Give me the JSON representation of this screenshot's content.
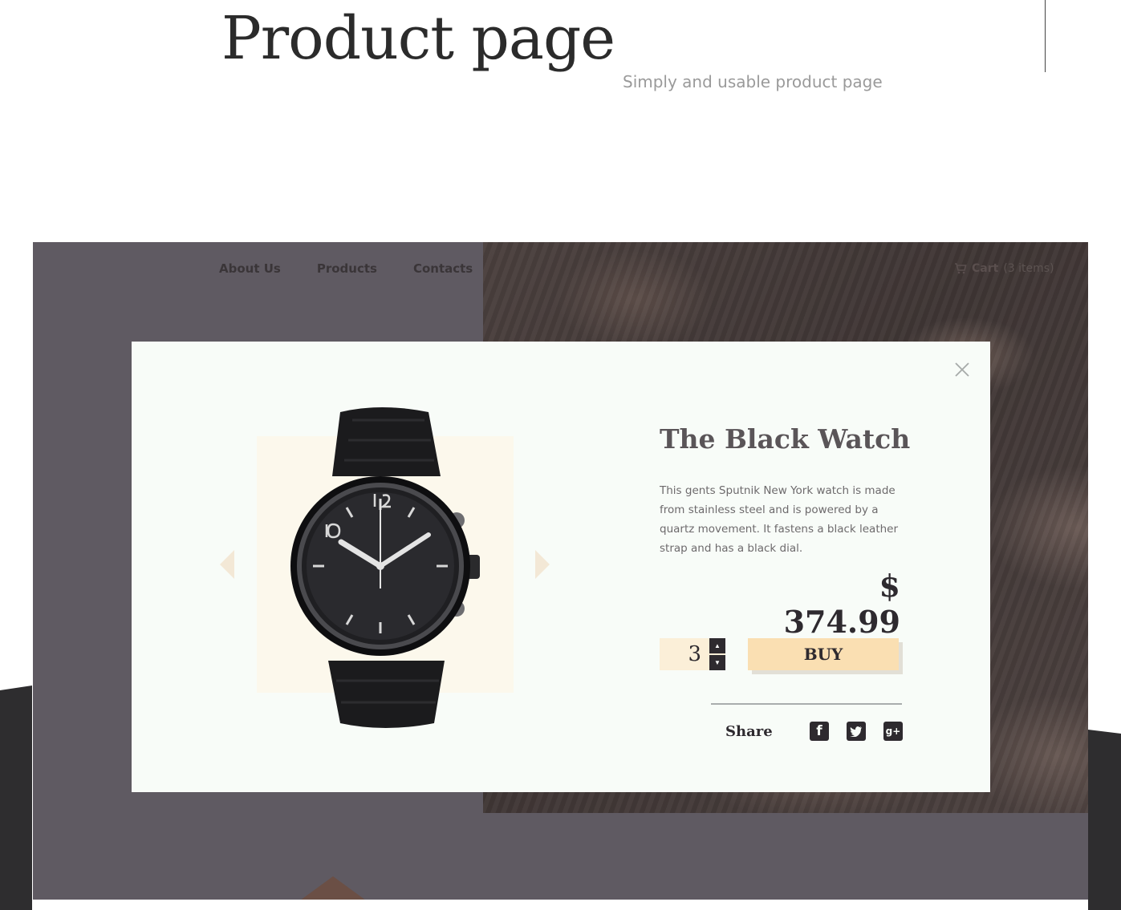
{
  "header": {
    "title": "Product page",
    "subtitle": "Simply and usable product page"
  },
  "nav": {
    "items": [
      "About Us",
      "Products",
      "Contacts"
    ],
    "cart_label": "Cart",
    "cart_count": "(3 items)"
  },
  "product": {
    "title": "The Black Watch",
    "description": "This gents Sputnik New York watch is made from stainless steel and is powered by a quartz movement. It fastens a black leather strap and has a black dial.",
    "price": "$ 374.99",
    "quantity": "3",
    "buy_label": "BUY",
    "share_label": "Share"
  },
  "icons": {
    "close": "close-icon",
    "prev": "chevron-left-icon",
    "next": "chevron-right-icon",
    "cart": "cart-icon",
    "facebook": "facebook-icon",
    "twitter": "twitter-icon",
    "google_plus": "google-plus-icon"
  },
  "colors": {
    "accent": "#fadfb2",
    "dark": "#2e2a2f",
    "frame": "#5f5a62",
    "modal_bg": "#f8fcf8"
  }
}
